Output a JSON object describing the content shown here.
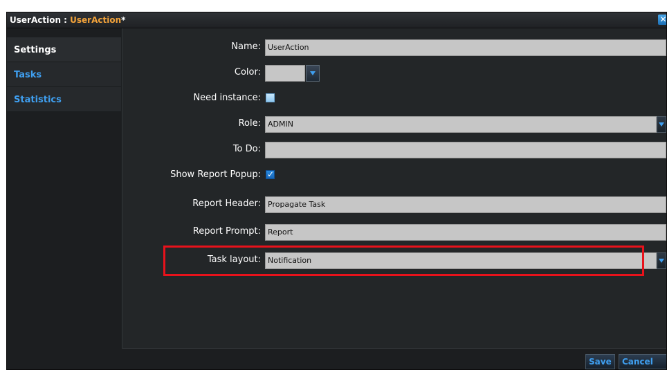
{
  "window": {
    "title_prefix": "UserAction : ",
    "title_name": "UserAction",
    "title_suffix": "*",
    "close_glyph": "✕"
  },
  "sidebar": {
    "items": [
      {
        "label": "Settings",
        "active": true
      },
      {
        "label": "Tasks",
        "active": false
      },
      {
        "label": "Statistics",
        "active": false
      }
    ]
  },
  "form": {
    "name": {
      "label": "Name:",
      "value": "UserAction"
    },
    "color": {
      "label": "Color:",
      "value": ""
    },
    "need_instance": {
      "label": "Need instance:",
      "checked": false
    },
    "role": {
      "label": "Role:",
      "value": "ADMIN"
    },
    "todo": {
      "label": "To Do:",
      "value": ""
    },
    "show_report_popup": {
      "label": "Show Report Popup:",
      "checked": true,
      "glyph": "✓"
    },
    "report_header": {
      "label": "Report Header:",
      "value": "Propagate Task"
    },
    "report_prompt": {
      "label": "Report Prompt:",
      "value": "Report"
    },
    "task_layout": {
      "label": "Task layout:",
      "value": "Notification"
    }
  },
  "footer": {
    "save_label": "Save",
    "cancel_label": "Cancel"
  },
  "colors": {
    "accent": "#3f9ff0",
    "title_accent": "#f3a33a",
    "highlight": "#e8121b"
  }
}
